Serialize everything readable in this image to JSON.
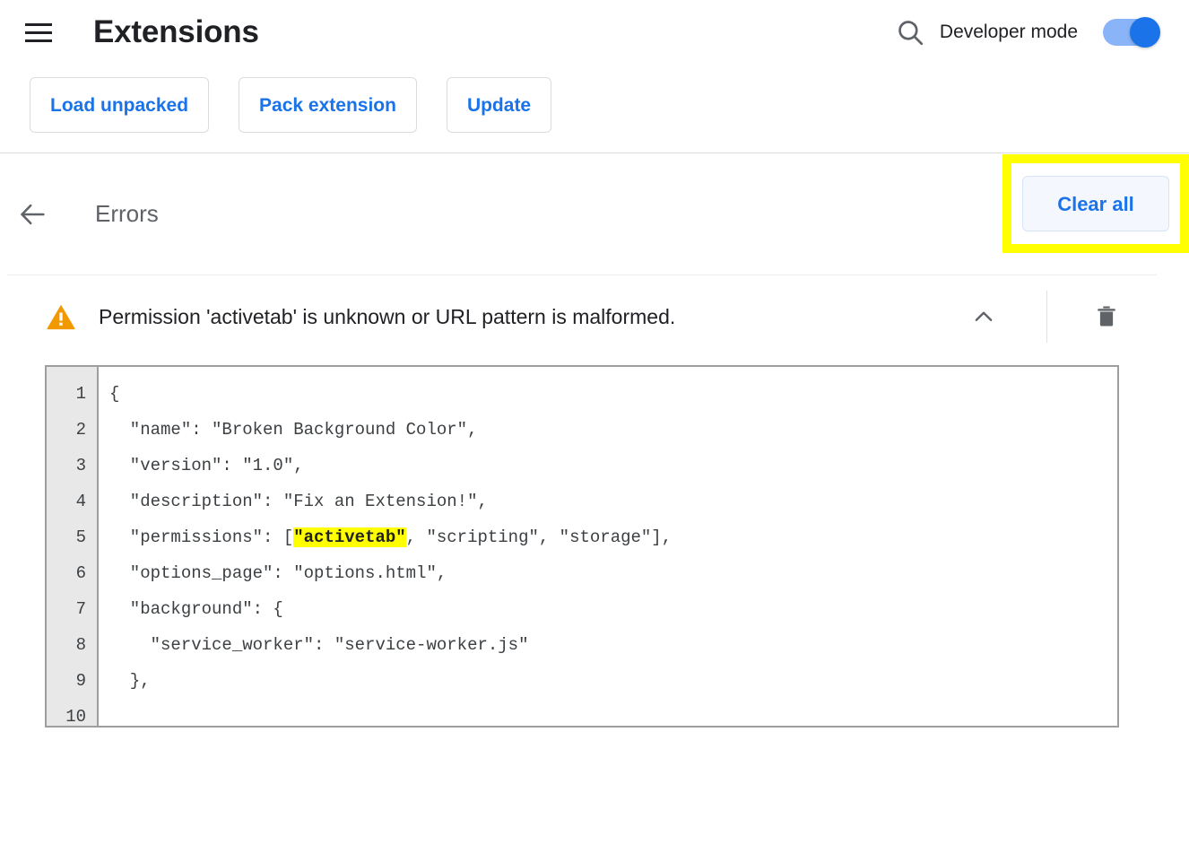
{
  "header": {
    "menu_icon": "hamburger-menu-icon",
    "title": "Extensions",
    "search_icon": "search-icon",
    "developer_mode_label": "Developer mode",
    "developer_mode_on": true
  },
  "toolbar": {
    "buttons": [
      {
        "label": "Load unpacked"
      },
      {
        "label": "Pack extension"
      },
      {
        "label": "Update"
      }
    ]
  },
  "errors_page": {
    "back_icon": "arrow-back-icon",
    "title": "Errors",
    "clear_all_label": "Clear all",
    "highlight_color": "#ffff00"
  },
  "error_item": {
    "severity_icon": "warning-triangle-icon",
    "message": "Permission 'activetab' is unknown or URL pattern is malformed.",
    "collapse_icon": "chevron-up-icon",
    "delete_icon": "trash-icon",
    "expanded": true
  },
  "code_viewer": {
    "line_numbers": [
      "1",
      "2",
      "3",
      "4",
      "5",
      "6",
      "7",
      "8",
      "9",
      "10"
    ],
    "lines": [
      {
        "before": "{",
        "highlight": "",
        "after": ""
      },
      {
        "before": "  \"name\": \"Broken Background Color\",",
        "highlight": "",
        "after": ""
      },
      {
        "before": "  \"version\": \"1.0\",",
        "highlight": "",
        "after": ""
      },
      {
        "before": "  \"description\": \"Fix an Extension!\",",
        "highlight": "",
        "after": ""
      },
      {
        "before": "  \"permissions\": [",
        "highlight": "\"activetab\"",
        "after": ", \"scripting\", \"storage\"],"
      },
      {
        "before": "  \"options_page\": \"options.html\",",
        "highlight": "",
        "after": ""
      },
      {
        "before": "  \"background\": {",
        "highlight": "",
        "after": ""
      },
      {
        "before": "    \"service_worker\": \"service-worker.js\"",
        "highlight": "",
        "after": ""
      },
      {
        "before": "  },",
        "highlight": "",
        "after": ""
      },
      {
        "before": "",
        "highlight": "",
        "after": ""
      }
    ]
  },
  "colors": {
    "accent_blue": "#1a73e8",
    "toggle_track": "#8ab4f8",
    "warning_orange": "#f29900",
    "highlight_yellow": "#ffff00",
    "text_primary": "#202124",
    "text_secondary": "#5f6368"
  }
}
